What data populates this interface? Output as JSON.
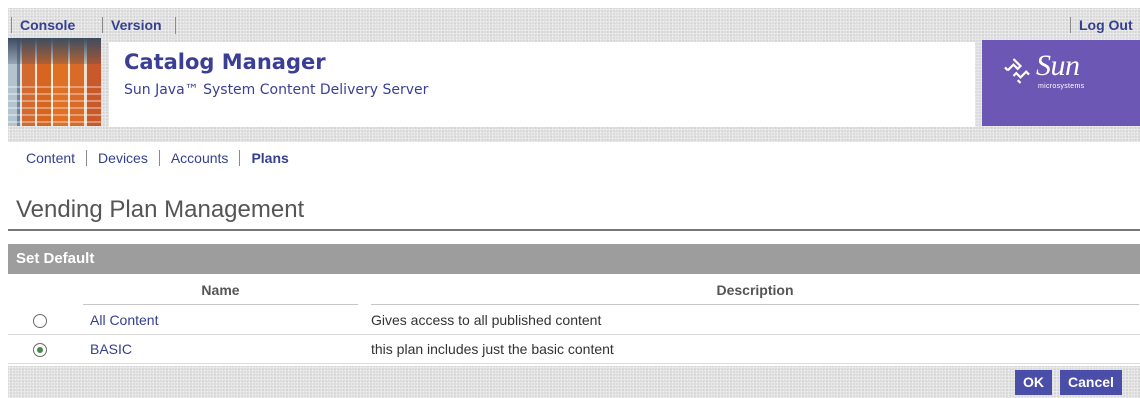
{
  "header": {
    "nav_console": "Console",
    "nav_version": "Version",
    "logout": "Log Out",
    "app_title": "Catalog Manager",
    "app_subtitle": "Sun Java™ System Content Delivery Server",
    "logo_text": "Sun",
    "logo_subtext": "microsystems",
    "logo_color": "#6c58b4"
  },
  "tabs": [
    {
      "label": "Content",
      "active": false
    },
    {
      "label": "Devices",
      "active": false
    },
    {
      "label": "Accounts",
      "active": false
    },
    {
      "label": "Plans",
      "active": true
    }
  ],
  "page": {
    "title": "Vending Plan Management",
    "section_title": "Set Default"
  },
  "table": {
    "columns": [
      "Name",
      "Description"
    ],
    "rows": [
      {
        "name": "All Content",
        "description": "Gives access to all published content",
        "selected": false
      },
      {
        "name": "BASIC",
        "description": "this plan includes just the basic content",
        "selected": true
      }
    ]
  },
  "buttons": {
    "ok": "OK",
    "cancel": "Cancel"
  },
  "colors": {
    "link": "#35408f",
    "button": "#4a4ea8",
    "section_header": "#9d9d9d",
    "radio_selected": "#47894a"
  }
}
